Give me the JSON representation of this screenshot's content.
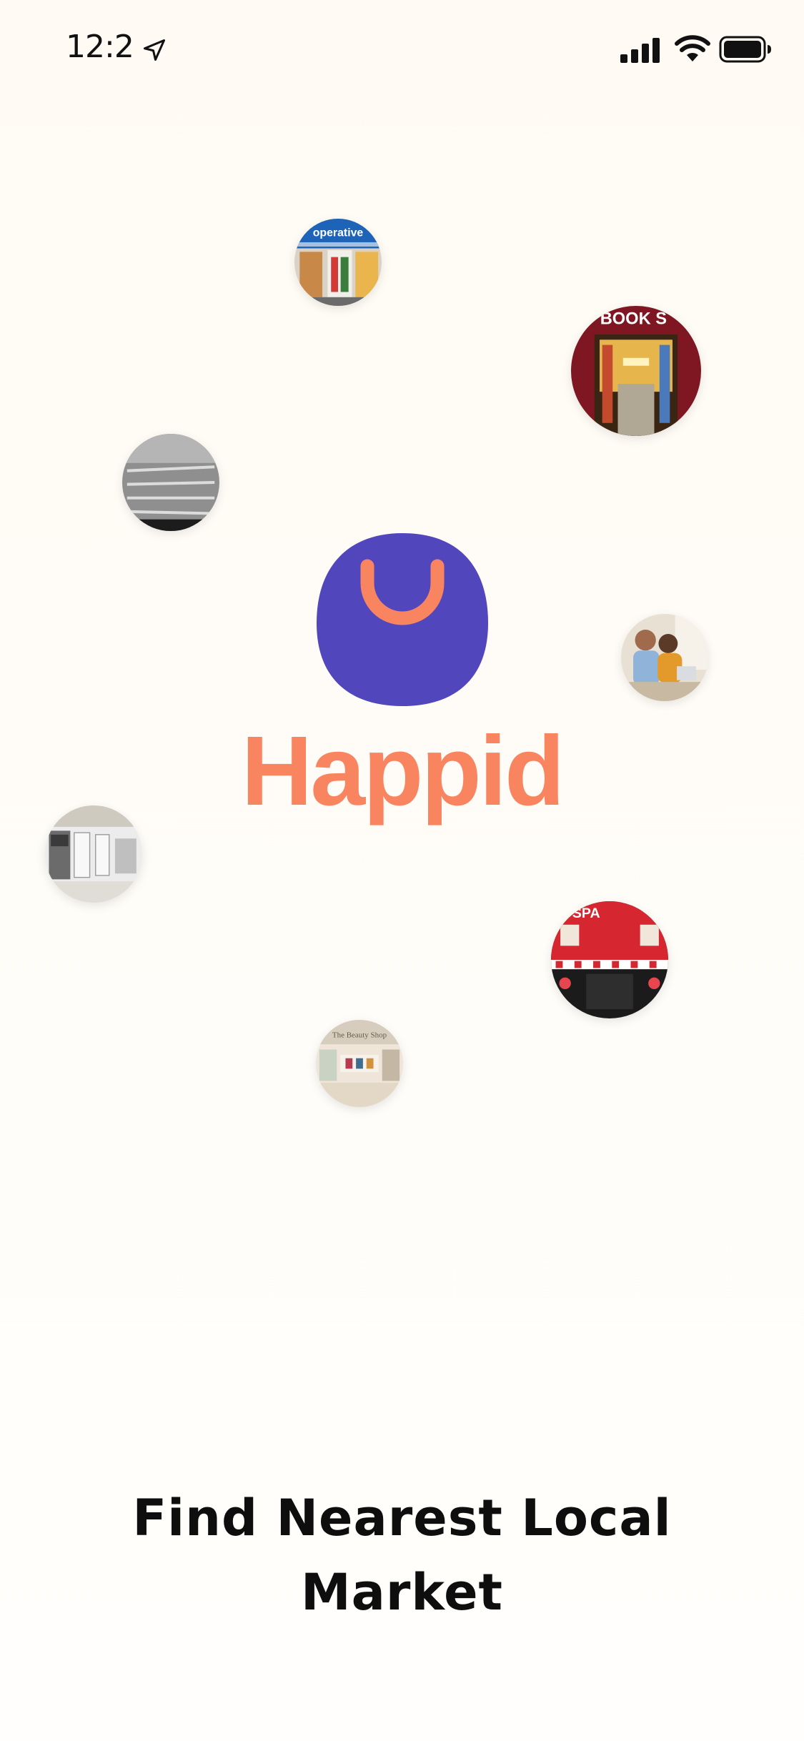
{
  "status_bar": {
    "time": "12:2",
    "icons": [
      "location-arrow-icon",
      "cellular-signal-icon",
      "wifi-icon",
      "battery-icon"
    ]
  },
  "brand": {
    "name": "Happid",
    "logo_icon": "shopping-bag-smile-icon",
    "colors": {
      "primary": "#5246bd",
      "accent": "#f98560",
      "background": "#fffcf7",
      "text": "#0e0e0e"
    }
  },
  "store_photos": [
    {
      "name": "cooperative-store-photo",
      "sign_text": "operative"
    },
    {
      "name": "bookstore-photo",
      "sign_text": "BOOK S"
    },
    {
      "name": "hardware-aisle-photo"
    },
    {
      "name": "couple-at-laptop-photo"
    },
    {
      "name": "appliance-showroom-photo"
    },
    {
      "name": "spa-storefront-photo",
      "sign_text": "SPA"
    },
    {
      "name": "beauty-shop-photo",
      "sign_text": "The Beauty Shop"
    }
  ],
  "headline": {
    "line1": "Find Nearest Local",
    "line2": "Market"
  }
}
